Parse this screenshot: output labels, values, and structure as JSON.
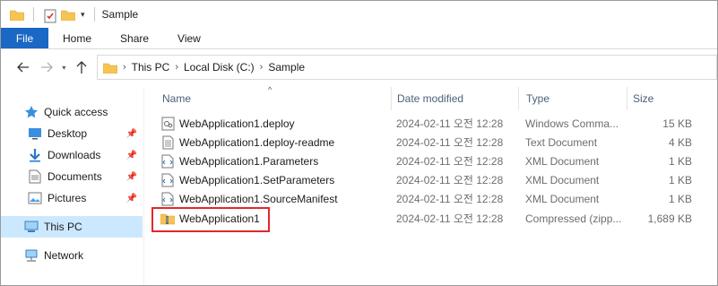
{
  "window": {
    "title": "Sample"
  },
  "ribbon": {
    "tabs": [
      "File",
      "Home",
      "Share",
      "View"
    ]
  },
  "address": {
    "crumbs": [
      "This PC",
      "Local Disk (C:)",
      "Sample"
    ]
  },
  "nav": {
    "quick_access": "Quick access",
    "pinned": [
      "Desktop",
      "Downloads",
      "Documents",
      "Pictures"
    ],
    "this_pc": "This PC",
    "network": "Network"
  },
  "columns": {
    "name": "Name",
    "date": "Date modified",
    "type": "Type",
    "size": "Size"
  },
  "files": [
    {
      "name": "WebApplication1.deploy",
      "date": "2024-02-11 오전 12:28",
      "type": "Windows Comma...",
      "size": "15 KB",
      "icon": "cmd-script-icon"
    },
    {
      "name": "WebApplication1.deploy-readme",
      "date": "2024-02-11 오전 12:28",
      "type": "Text Document",
      "size": "4 KB",
      "icon": "text-document-icon"
    },
    {
      "name": "WebApplication1.Parameters",
      "date": "2024-02-11 오전 12:28",
      "type": "XML Document",
      "size": "1 KB",
      "icon": "xml-document-icon"
    },
    {
      "name": "WebApplication1.SetParameters",
      "date": "2024-02-11 오전 12:28",
      "type": "XML Document",
      "size": "1 KB",
      "icon": "xml-document-icon"
    },
    {
      "name": "WebApplication1.SourceManifest",
      "date": "2024-02-11 오전 12:28",
      "type": "XML Document",
      "size": "1 KB",
      "icon": "xml-document-icon"
    },
    {
      "name": "WebApplication1",
      "date": "2024-02-11 오전 12:28",
      "type": "Compressed (zipp...",
      "size": "1,689 KB",
      "icon": "zip-folder-icon"
    }
  ],
  "colors": {
    "file_tab": "#1a67c4",
    "selected_nav": "#cce8ff",
    "highlight": "#e0282d",
    "folder": "#f5c452"
  }
}
